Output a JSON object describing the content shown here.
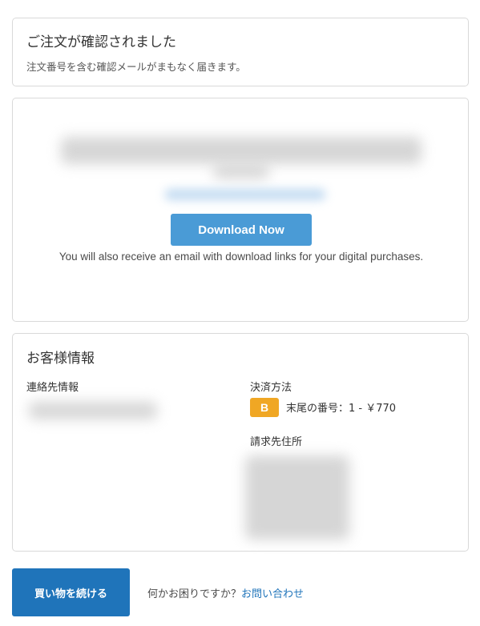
{
  "confirmation": {
    "title": "ご注文が確認されました",
    "subtitle": "注文番号を含む確認メールがまもなく届きます。"
  },
  "download": {
    "button_label": "Download Now",
    "note": "You will also receive an email with download links for your digital purchases."
  },
  "customer": {
    "title": "お客様情報",
    "contact_label": "連絡先情報",
    "payment_label": "決済方法",
    "payment_badge": "B",
    "payment_text": "末尾の番号：1 - ￥770",
    "billing_label": "請求先住所"
  },
  "footer": {
    "continue_label": "買い物を続ける",
    "help_text": "何かお困りですか？",
    "contact_link": "お問い合わせ"
  },
  "colors": {
    "download_button": "#4a9bd6",
    "continue_button": "#1f74ba",
    "link": "#1f74ba",
    "payment_badge": "#f0a724"
  }
}
